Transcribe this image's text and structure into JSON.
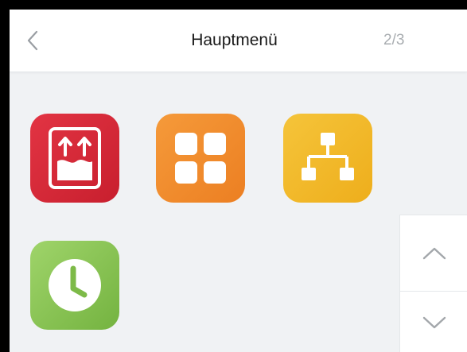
{
  "header": {
    "title": "Hauptmenü",
    "page_indicator": "2/3",
    "back_icon": "chevron-left-icon"
  },
  "menu": {
    "tiles": [
      {
        "icon": "ventilation-icon",
        "color": "#d7293a"
      },
      {
        "icon": "grid-icon",
        "color": "#f08c2c"
      },
      {
        "icon": "network-icon",
        "color": "#f2b92a"
      },
      {
        "icon": "clock-icon",
        "color": "#86c152"
      }
    ]
  },
  "scroll": {
    "up_icon": "chevron-up-icon",
    "down_icon": "chevron-down-icon"
  },
  "colors": {
    "background": "#f0f2f4",
    "header_bg": "#ffffff",
    "frame": "#000000"
  }
}
